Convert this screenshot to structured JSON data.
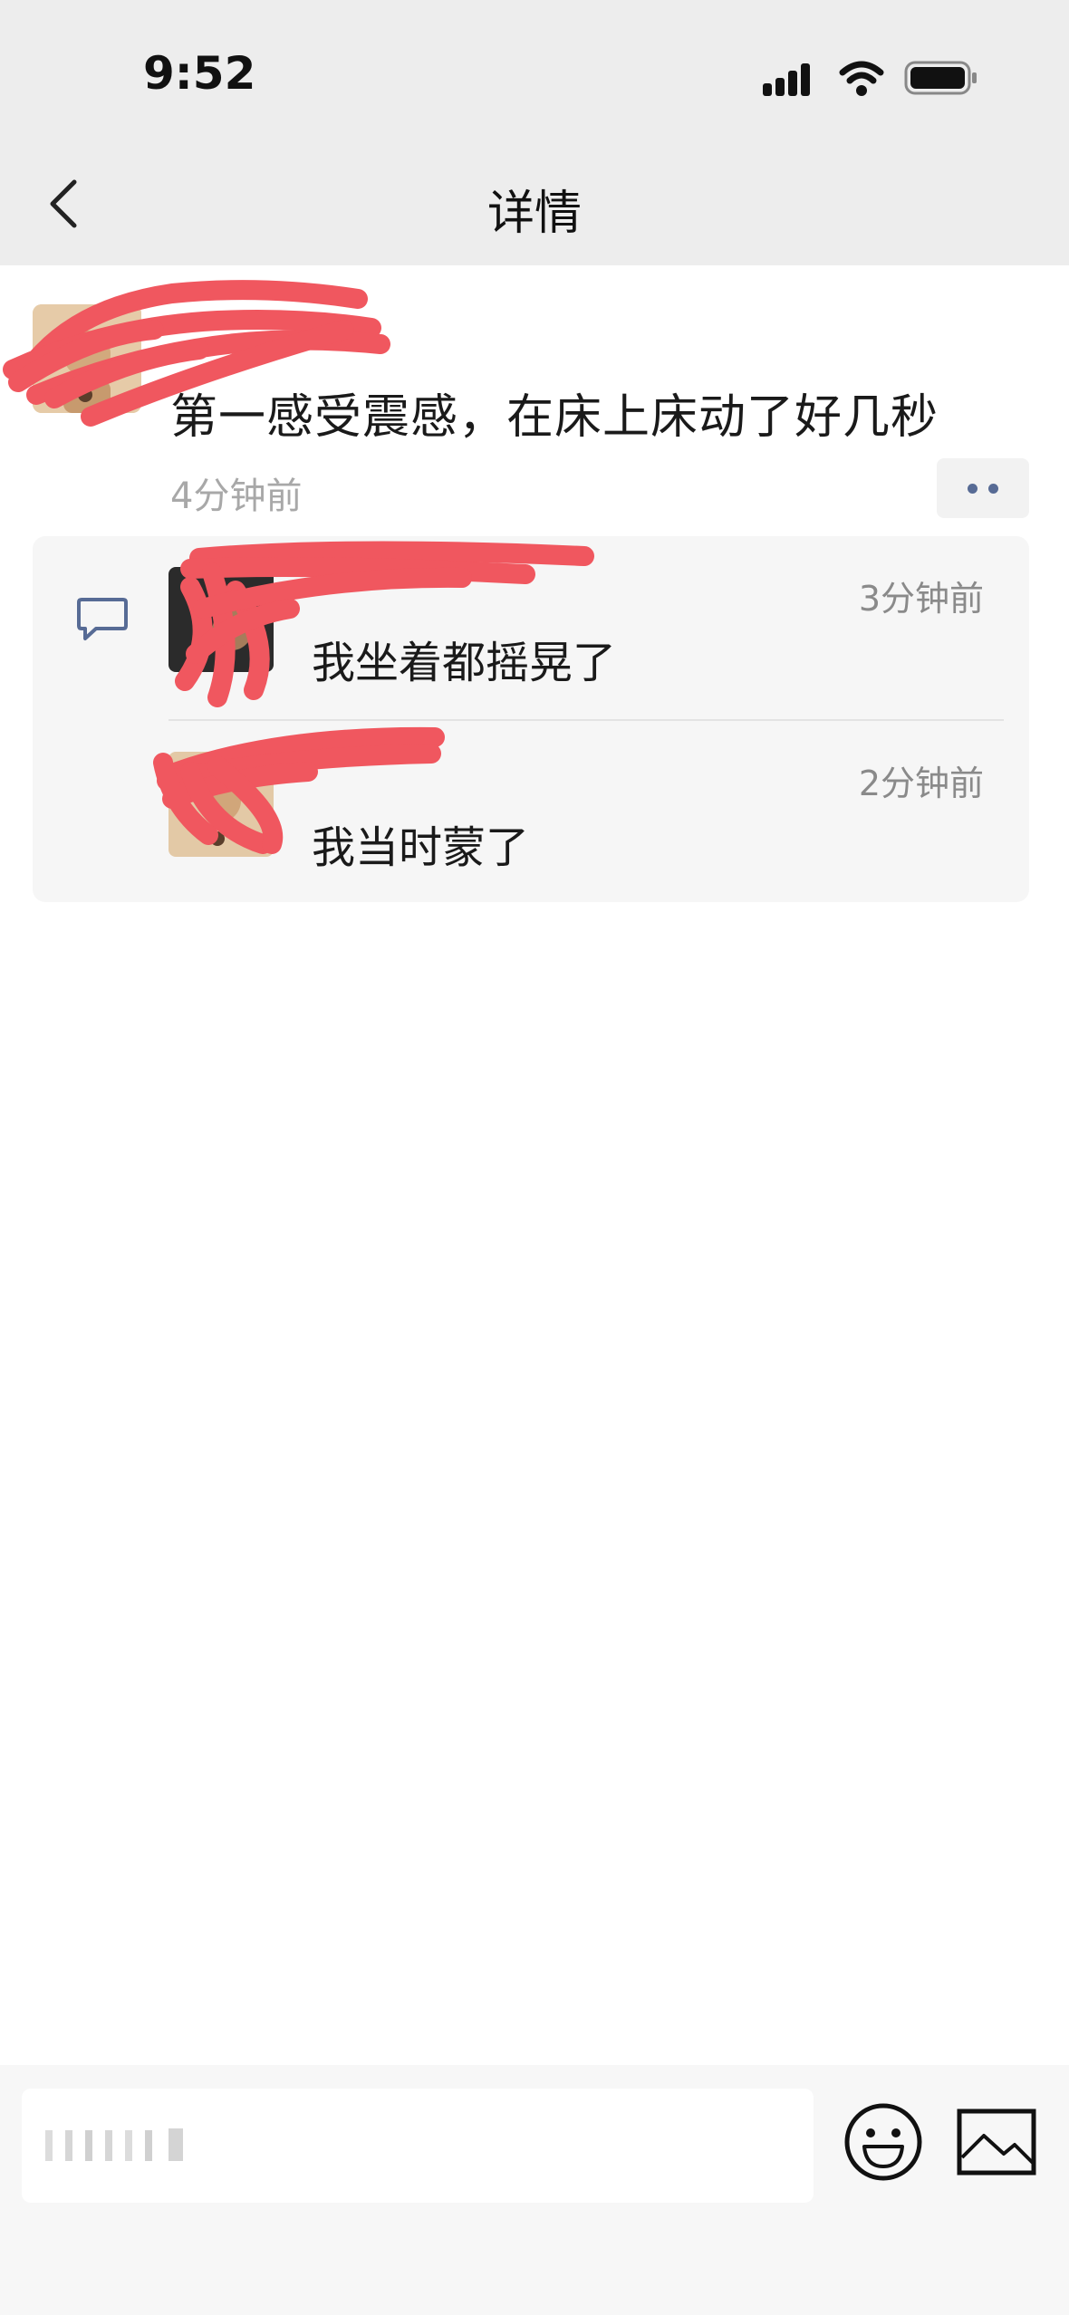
{
  "status_bar": {
    "time": "9:52"
  },
  "nav": {
    "title": "详情",
    "back_icon": "chevron-left-icon"
  },
  "post": {
    "author": "",
    "text": "第一感受震感，在床上床动了好几秒",
    "time": "4分钟前",
    "more_icon": "more-dots-icon"
  },
  "comments": [
    {
      "author": "",
      "text": "我坐着都摇晃了",
      "time": "3分钟前"
    },
    {
      "author": "",
      "text": "我当时蒙了",
      "time": "2分钟前"
    }
  ],
  "input_bar": {
    "placeholder": "",
    "emoji_icon": "emoji-icon",
    "image_icon": "image-icon"
  },
  "colors": {
    "link_name": "#576b95",
    "redaction": "#f0575f",
    "header_bg": "#ededed",
    "comments_bg": "#f6f6f6"
  }
}
